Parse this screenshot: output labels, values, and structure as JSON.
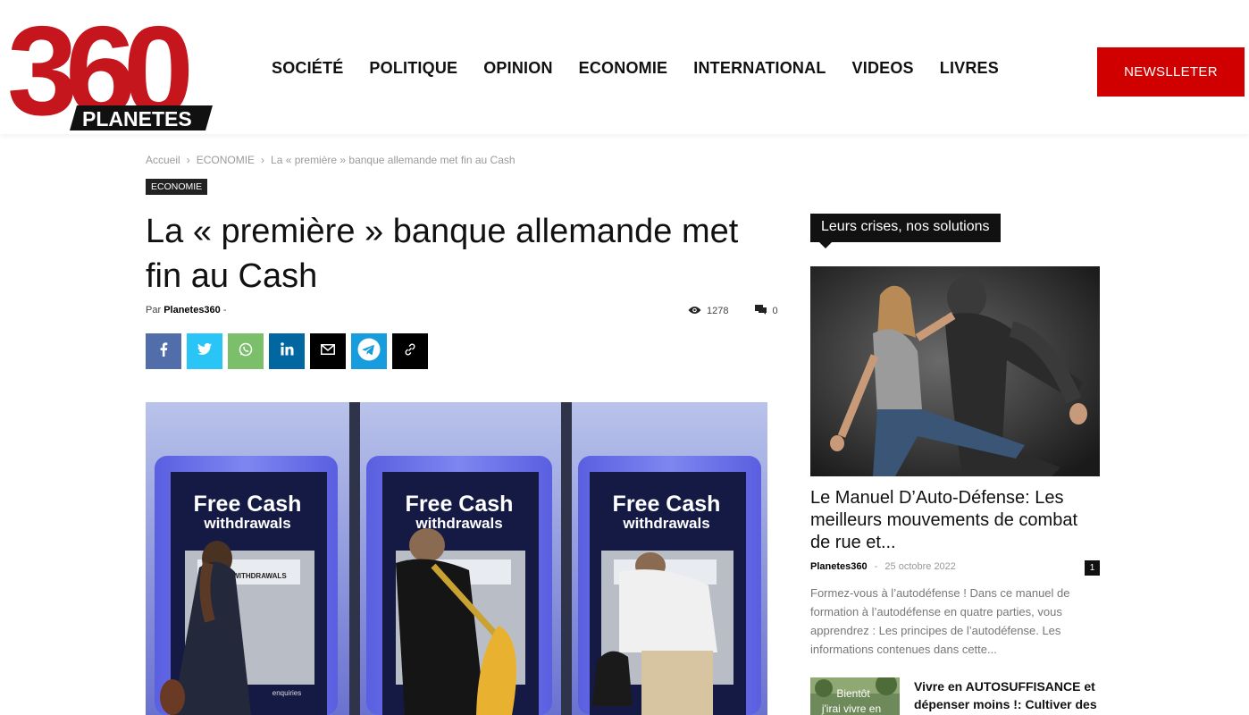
{
  "brand": {
    "logo_number": "360",
    "logo_text": "PLANETES",
    "accent": "#d00000"
  },
  "nav": {
    "items": [
      "SOCIÉTÉ",
      "POLITIQUE",
      "OPINION",
      "ECONOMIE",
      "INTERNATIONAL",
      "VIDEOS",
      "LIVRES"
    ],
    "newsletter_label": "NEWSLLETER"
  },
  "breadcrumb": {
    "home": "Accueil",
    "sep": "›",
    "category": "ECONOMIE",
    "current": "La « première » banque allemande met fin au Cash"
  },
  "article": {
    "category_tag": "ECONOMIE",
    "title": "La « première » banque allemande met fin au Cash",
    "by_label": "Par",
    "author": "Planetes360",
    "dash": "-",
    "views": "1278",
    "comments": "0",
    "hero_image": {
      "atm_headline": "Free Cash",
      "atm_sub": "withdrawals",
      "atm_screen": "CASH WITHDRAWALS",
      "atm_footer": "enquiries"
    }
  },
  "share": {
    "icons": [
      "facebook-icon",
      "twitter-icon",
      "whatsapp-icon",
      "linkedin-icon",
      "email-icon",
      "telegram-icon",
      "copy-link-icon"
    ],
    "colors": [
      "#516eab",
      "#29c5f6",
      "#7bbf6a",
      "#0266a0",
      "#000000",
      "#179cde",
      "#000000"
    ]
  },
  "sidebar": {
    "section_title": "Leurs crises, nos solutions",
    "featured": {
      "title": "Le Manuel D’Auto-Défense: Les meilleurs mouvements de combat de rue et...",
      "author": "Planetes360",
      "sep": "-",
      "date": "25 octobre 2022",
      "comments": "1",
      "excerpt": "Formez-vous à l’autodéfense ! Dans ce manuel de formation à l’autodéfense en quatre parties, vous apprendrez : Les principes de l’autodéfense. Les informations contenues dans cette..."
    },
    "second": {
      "thumb_text_1": "Bientôt",
      "thumb_text_2": "j'irai vivre en",
      "title": "Vivre en AUTOSUFFISANCE et dépenser moins !: Cultiver des"
    }
  }
}
